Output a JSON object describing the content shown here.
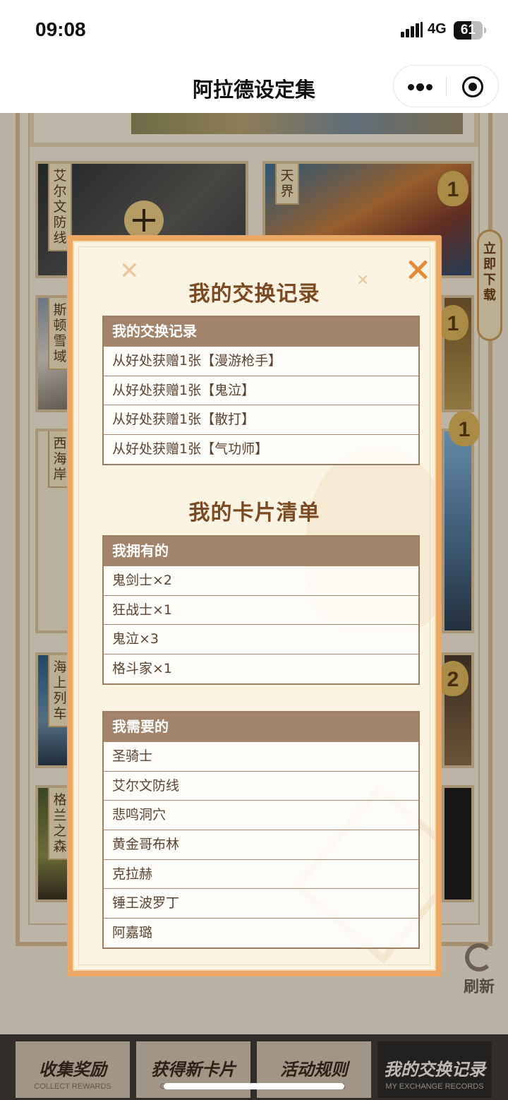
{
  "status_bar": {
    "time": "09:08",
    "network": "4G",
    "battery": "61",
    "battery_level": 0.61
  },
  "nav": {
    "title": "阿拉德设定集"
  },
  "background": {
    "cards": [
      {
        "label": "艾尔文防线"
      },
      {
        "label": "天界",
        "badge": "1"
      },
      {
        "label": "斯顿雪域"
      },
      {
        "badge": "1"
      },
      {
        "label": "西海岸",
        "badge": "1"
      },
      {
        "label": "海上列车"
      },
      {
        "badge": "2"
      },
      {
        "label": "格兰之森"
      }
    ],
    "side_download": "立即下载",
    "refresh_label": "刷新"
  },
  "tabs": [
    {
      "label": "收集奖励",
      "sub": "COLLECT REWARDS"
    },
    {
      "label": "获得新卡片",
      "sub": "GET A NEW CARD"
    },
    {
      "label": "活动规则",
      "sub": "ACTIVITY RULES"
    },
    {
      "label": "我的交换记录",
      "sub": "MY EXCHANGE RECORDS"
    }
  ],
  "modal": {
    "exchange_title": "我的交换记录",
    "exchange_table": {
      "header": "我的交换记录",
      "rows": [
        "从好处获赠1张【漫游枪手】",
        "从好处获赠1张【鬼泣】",
        "从好处获赠1张【散打】",
        "从好处获赠1张【气功师】"
      ]
    },
    "cards_title": "我的卡片清单",
    "owned_table": {
      "header": "我拥有的",
      "rows": [
        "鬼剑士×2",
        "狂战士×1",
        "鬼泣×3",
        "格斗家×1"
      ]
    },
    "needed_table": {
      "header": "我需要的",
      "rows": [
        "圣骑士",
        "艾尔文防线",
        "悲鸣洞穴",
        "黄金哥布林",
        "克拉赫",
        "锤王波罗丁",
        "阿嘉璐"
      ]
    }
  }
}
